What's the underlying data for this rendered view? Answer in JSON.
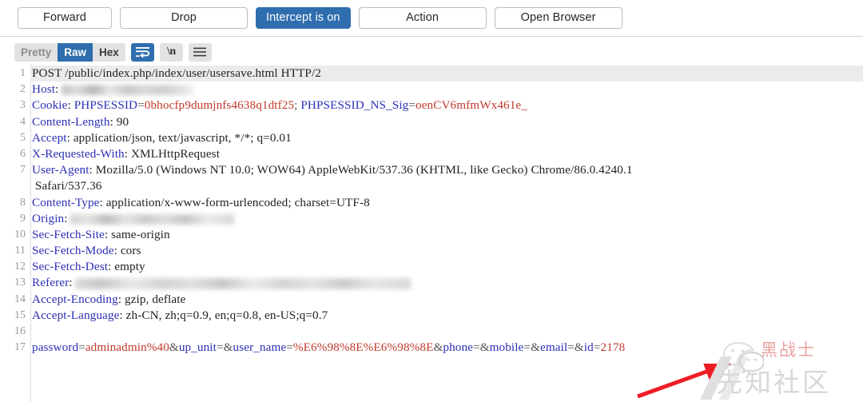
{
  "colors": {
    "accent": "#2f6eae",
    "header_blue": "#2b2fb5",
    "value_red": "#c0392b",
    "arrow_red": "#ee1c25",
    "line_highlight": "#ebebeb"
  },
  "toolbar": {
    "buttons": [
      {
        "label": "Forward",
        "style": "default"
      },
      {
        "label": "Drop",
        "style": "default"
      },
      {
        "label": "Intercept is on",
        "style": "primary"
      },
      {
        "label": "Action",
        "style": "default"
      },
      {
        "label": "Open Browser",
        "style": "default"
      }
    ]
  },
  "viewbar": {
    "segments": [
      {
        "label": "Pretty",
        "state": "inactive"
      },
      {
        "label": "Raw",
        "state": "active"
      },
      {
        "label": "Hex",
        "state": "inactive"
      }
    ],
    "icons": [
      {
        "name": "word-wrap-icon",
        "state": "active"
      },
      {
        "name": "newline-icon",
        "label": "\\n",
        "state": "inactive"
      },
      {
        "name": "menu-icon",
        "state": "inactive"
      }
    ]
  },
  "editor": {
    "highlighted_line": 1,
    "lines": [
      {
        "n": "1",
        "type": "request-line",
        "text": "POST /public/index.php/index/user/usersave.html HTTP/2"
      },
      {
        "n": "2",
        "type": "header",
        "name": "Host",
        "value": "",
        "redacted": "host"
      },
      {
        "n": "3",
        "type": "cookie",
        "name": "Cookie",
        "cookie1_name": "PHPSESSID",
        "cookie1_value": "0bhocfp9dumjnfs4638q1dtf25",
        "cookie2_name": "PHPSESSID_NS_Sig",
        "cookie2_value": "oenCV6mfmWx461e_"
      },
      {
        "n": "4",
        "type": "header",
        "name": "Content-Length",
        "value": "90"
      },
      {
        "n": "5",
        "type": "header",
        "name": "Accept",
        "value": "application/json, text/javascript, */*; q=0.01"
      },
      {
        "n": "6",
        "type": "header",
        "name": "X-Requested-With",
        "value": "XMLHttpRequest"
      },
      {
        "n": "7",
        "type": "header",
        "name": "User-Agent",
        "value": "Mozilla/5.0 (Windows NT 10.0; WOW64) AppleWebKit/537.36 (KHTML, like Gecko) Chrome/86.0.4240.1"
      },
      {
        "n": "",
        "type": "continuation",
        "text": "Safari/537.36"
      },
      {
        "n": "8",
        "type": "header",
        "name": "Content-Type",
        "value": "application/x-www-form-urlencoded; charset=UTF-8"
      },
      {
        "n": "9",
        "type": "header",
        "name": "Origin",
        "value": "",
        "redacted": "origin"
      },
      {
        "n": "10",
        "type": "header",
        "name": "Sec-Fetch-Site",
        "value": "same-origin"
      },
      {
        "n": "11",
        "type": "header",
        "name": "Sec-Fetch-Mode",
        "value": "cors"
      },
      {
        "n": "12",
        "type": "header",
        "name": "Sec-Fetch-Dest",
        "value": "empty"
      },
      {
        "n": "13",
        "type": "header",
        "name": "Referer",
        "value": "",
        "redacted": "referer"
      },
      {
        "n": "14",
        "type": "header",
        "name": "Accept-Encoding",
        "value": "gzip, deflate"
      },
      {
        "n": "15",
        "type": "header",
        "name": "Accept-Language",
        "value": "zh-CN, zh;q=0.9, en;q=0.8, en-US;q=0.7"
      },
      {
        "n": "16",
        "type": "blank",
        "text": ""
      },
      {
        "n": "17",
        "type": "body",
        "text": "password=adminadmin%40&up_unit=&user_name=%E6%98%8E%E6%98%8E&phone=&mobile=&email=&id=2178",
        "params": [
          {
            "key": "password",
            "value": "adminadmin%40"
          },
          {
            "key": "up_unit",
            "value": ""
          },
          {
            "key": "user_name",
            "value": "%E6%98%8E%E6%98%8E"
          },
          {
            "key": "phone",
            "value": ""
          },
          {
            "key": "mobile",
            "value": ""
          },
          {
            "key": "email",
            "value": ""
          },
          {
            "key": "id",
            "value": "2178"
          }
        ]
      }
    ]
  },
  "annotation": {
    "arrow": {
      "name": "red-arrow",
      "points_to": "id=2178",
      "color": "#ee1c25"
    }
  },
  "watermark": {
    "title": "黑战士",
    "subtitle": "先知社区",
    "icon": "wechat-icon"
  }
}
